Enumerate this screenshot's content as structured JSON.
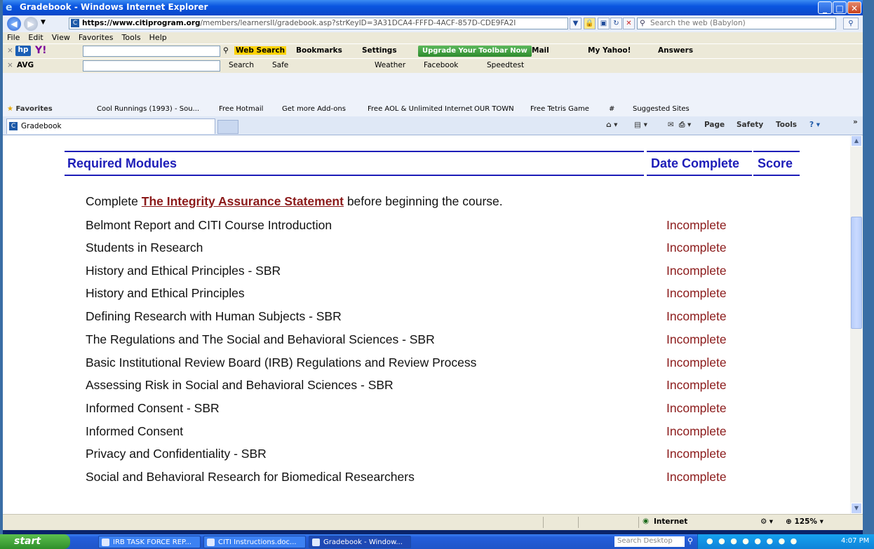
{
  "window": {
    "title": "Gradebook - Windows Internet Explorer",
    "minimize": "_",
    "maximize": "□",
    "close": "✕"
  },
  "address": {
    "url_prefix": "https://www.",
    "url_domain": "citiprogram.org",
    "url_rest": "/members/learnersII/gradebook.asp?strKeyID=3A31DCA4-FFFD-4ACF-857D-CDE9FA2I",
    "search_placeholder": "Search the web (Babylon)"
  },
  "menu": [
    "File",
    "Edit",
    "View",
    "Favorites",
    "Tools",
    "Help"
  ],
  "toolbar1": {
    "web_search": "Web Search",
    "bookmarks": "Bookmarks",
    "settings": "Settings",
    "upgrade": "Upgrade Your Toolbar Now",
    "mail": "Mail",
    "my_yahoo": "My Yahoo!",
    "answers": "Answers"
  },
  "toolbar2": {
    "avg": "AVG",
    "search": "Search",
    "safe": "Safe",
    "weather": "Weather",
    "facebook": "Facebook",
    "speedtest": "Speedtest"
  },
  "favorites": {
    "label": "Favorites",
    "items": [
      "Cool Runnings (1993) - Sou...",
      "Free Hotmail",
      "Get more Add-ons",
      "Free AOL & Unlimited Internet",
      "OUR TOWN",
      "Free Tetris Game",
      "#",
      "Suggested Sites"
    ]
  },
  "tab": {
    "label": "Gradebook",
    "commands": [
      "Page",
      "Safety",
      "Tools"
    ]
  },
  "table": {
    "header_modules": "Required Modules",
    "header_date": "Date Complete",
    "header_score": "Score",
    "intro_before": "Complete ",
    "intro_link": "The Integrity Assurance Statement",
    "intro_after": " before beginning the course.",
    "rows": [
      {
        "name": "Belmont Report and CITI Course Introduction",
        "status": "Incomplete"
      },
      {
        "name": "Students in Research",
        "status": "Incomplete"
      },
      {
        "name": "History and Ethical Principles - SBR",
        "status": "Incomplete"
      },
      {
        "name": "History and Ethical Principles",
        "status": "Incomplete"
      },
      {
        "name": "Defining Research with Human Subjects - SBR",
        "status": "Incomplete"
      },
      {
        "name": "The Regulations and The Social and Behavioral Sciences - SBR",
        "status": "Incomplete"
      },
      {
        "name": "Basic Institutional Review Board (IRB) Regulations and Review Process",
        "status": "Incomplete"
      },
      {
        "name": "Assessing Risk in Social and Behavioral Sciences - SBR",
        "status": "Incomplete"
      },
      {
        "name": "Informed Consent - SBR",
        "status": "Incomplete"
      },
      {
        "name": "Informed Consent",
        "status": "Incomplete"
      },
      {
        "name": "Privacy and Confidentiality - SBR",
        "status": "Incomplete"
      },
      {
        "name": "Social and Behavioral Research for Biomedical Researchers",
        "status": "Incomplete"
      }
    ]
  },
  "statusbar": {
    "zone": "Internet",
    "zoom": "125%"
  },
  "taskbar": {
    "start": "start",
    "items": [
      "IRB TASK FORCE REP...",
      "CITI Instructions.doc...",
      "Gradebook - Window..."
    ],
    "desktop_search": "Search Desktop",
    "clock": "4:07 PM"
  }
}
